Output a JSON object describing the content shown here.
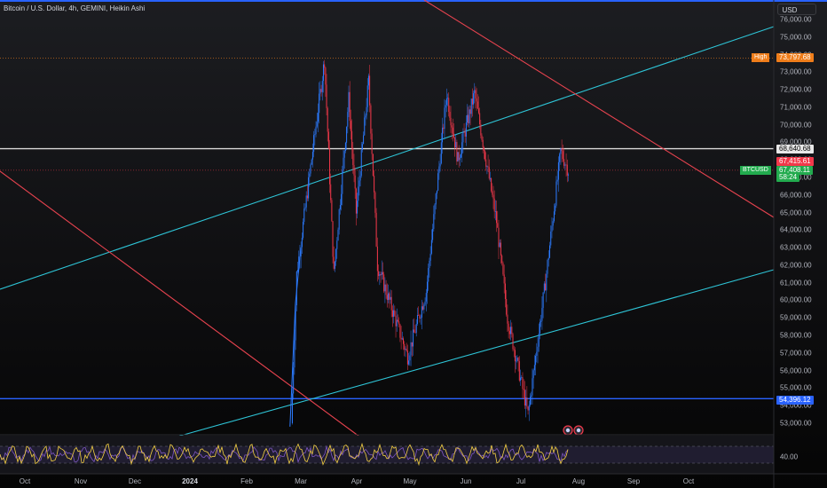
{
  "header": {
    "title": "Bitcoin / U.S. Dollar, 4h, GEMINI, Heikin Ashi",
    "currency_button": "USD"
  },
  "price_scale": {
    "ticks": [
      "76,000.00",
      "75,000.00",
      "74,000.00",
      "73,000.00",
      "72,000.00",
      "71,000.00",
      "70,000.00",
      "69,000.00",
      "68,000.00",
      "67,000.00",
      "66,000.00",
      "65,000.00",
      "64,000.00",
      "63,000.00",
      "62,000.00",
      "61,000.00",
      "60,000.00",
      "59,000.00",
      "58,000.00",
      "57,000.00",
      "56,000.00",
      "55,000.00",
      "54,000.00",
      "53,000.00"
    ],
    "high_label": "High",
    "high_value": "73,797.68",
    "hline_top_value": "68,640.68",
    "last_close_value": "67,415.61",
    "symbol_label": "BTCUSD",
    "symbol_price": "67,408.11",
    "countdown": "58:24",
    "hline_bottom_value": "54,396.12"
  },
  "rsi": {
    "tick": "40.00"
  },
  "time_scale": {
    "labels": [
      "Oct",
      "Nov",
      "Dec",
      "2024",
      "Feb",
      "Mar",
      "Apr",
      "May",
      "Jun",
      "Jul",
      "Aug",
      "Sep",
      "Oct"
    ]
  },
  "chart_data": {
    "type": "candlestick",
    "symbol": "BTCUSD",
    "exchange": "GEMINI",
    "timeframe": "4h",
    "style": "Heikin Ashi",
    "y_range": [
      52500,
      76500
    ],
    "x_labels": [
      "Oct",
      "Nov",
      "Dec",
      "2024",
      "Feb",
      "Mar",
      "Apr",
      "May",
      "Jun",
      "Jul",
      "Aug",
      "Sep",
      "Oct"
    ],
    "approx_swing_points": [
      {
        "x": "Feb 29",
        "y": 61500
      },
      {
        "x": "Mar 14",
        "y": 73700
      },
      {
        "x": "Mar 19",
        "y": 61500
      },
      {
        "x": "Mar 27",
        "y": 71500
      },
      {
        "x": "Apr 1",
        "y": 65000
      },
      {
        "x": "Apr 8",
        "y": 72500
      },
      {
        "x": "Apr 13",
        "y": 62000
      },
      {
        "x": "Apr 30",
        "y": 56800
      },
      {
        "x": "May 10",
        "y": 60500
      },
      {
        "x": "May 21",
        "y": 71800
      },
      {
        "x": "May 27",
        "y": 68000
      },
      {
        "x": "Jun 6",
        "y": 71800
      },
      {
        "x": "Jun 18",
        "y": 64500
      },
      {
        "x": "Jun 24",
        "y": 59000
      },
      {
        "x": "Jul 5",
        "y": 53500
      },
      {
        "x": "Jul 14",
        "y": 61000
      },
      {
        "x": "Jul 22",
        "y": 68500
      },
      {
        "x": "Jul 26",
        "y": 67400
      }
    ],
    "horizontal_lines": [
      68640.68,
      54396.12
    ],
    "session_high": 73797.68,
    "last_price": 67408.11
  },
  "colors": {
    "accent": "#2962ff",
    "trendline_cyan": "#2ec4d6",
    "trendline_red": "#e8434f",
    "up": "#2c7bff",
    "down": "#f2384a",
    "high_tag": "#ef7d1a",
    "symbol_tag": "#22ab4e",
    "last_tag": "#f2384a"
  }
}
